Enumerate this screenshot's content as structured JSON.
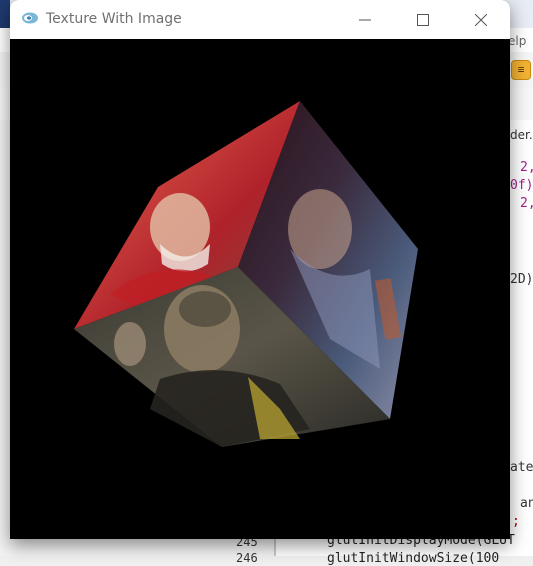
{
  "window": {
    "title": "Texture With Image",
    "controls": {
      "minimize": "minimize-icon",
      "maximize": "maximize-icon",
      "close": "close-icon"
    }
  },
  "viewport": {
    "background": "#000000",
    "scene": "textured-rotating-cube"
  },
  "ide_background": {
    "menu_fragment": "elp",
    "tab_fragment": "der.",
    "code_lines": [
      {
        "text": "2,",
        "color": "#a0218c"
      },
      {
        "text": "0f)",
        "color": "#a0218c"
      },
      {
        "text": "2,",
        "color": "#a0218c"
      },
      {
        "text": "2D)",
        "color": "#333333"
      },
      {
        "text": "ate",
        "color": "#333333"
      },
      {
        "text": "an",
        "color": "#333333"
      },
      {
        "text": ";",
        "color": "#c00000"
      },
      {
        "text": "glutInitDisplayMode(GLUT",
        "color": "#222222"
      },
      {
        "text": "glutInitWindowSize(100",
        "color": "#222222"
      }
    ],
    "line_numbers": [
      "245",
      "246"
    ]
  }
}
